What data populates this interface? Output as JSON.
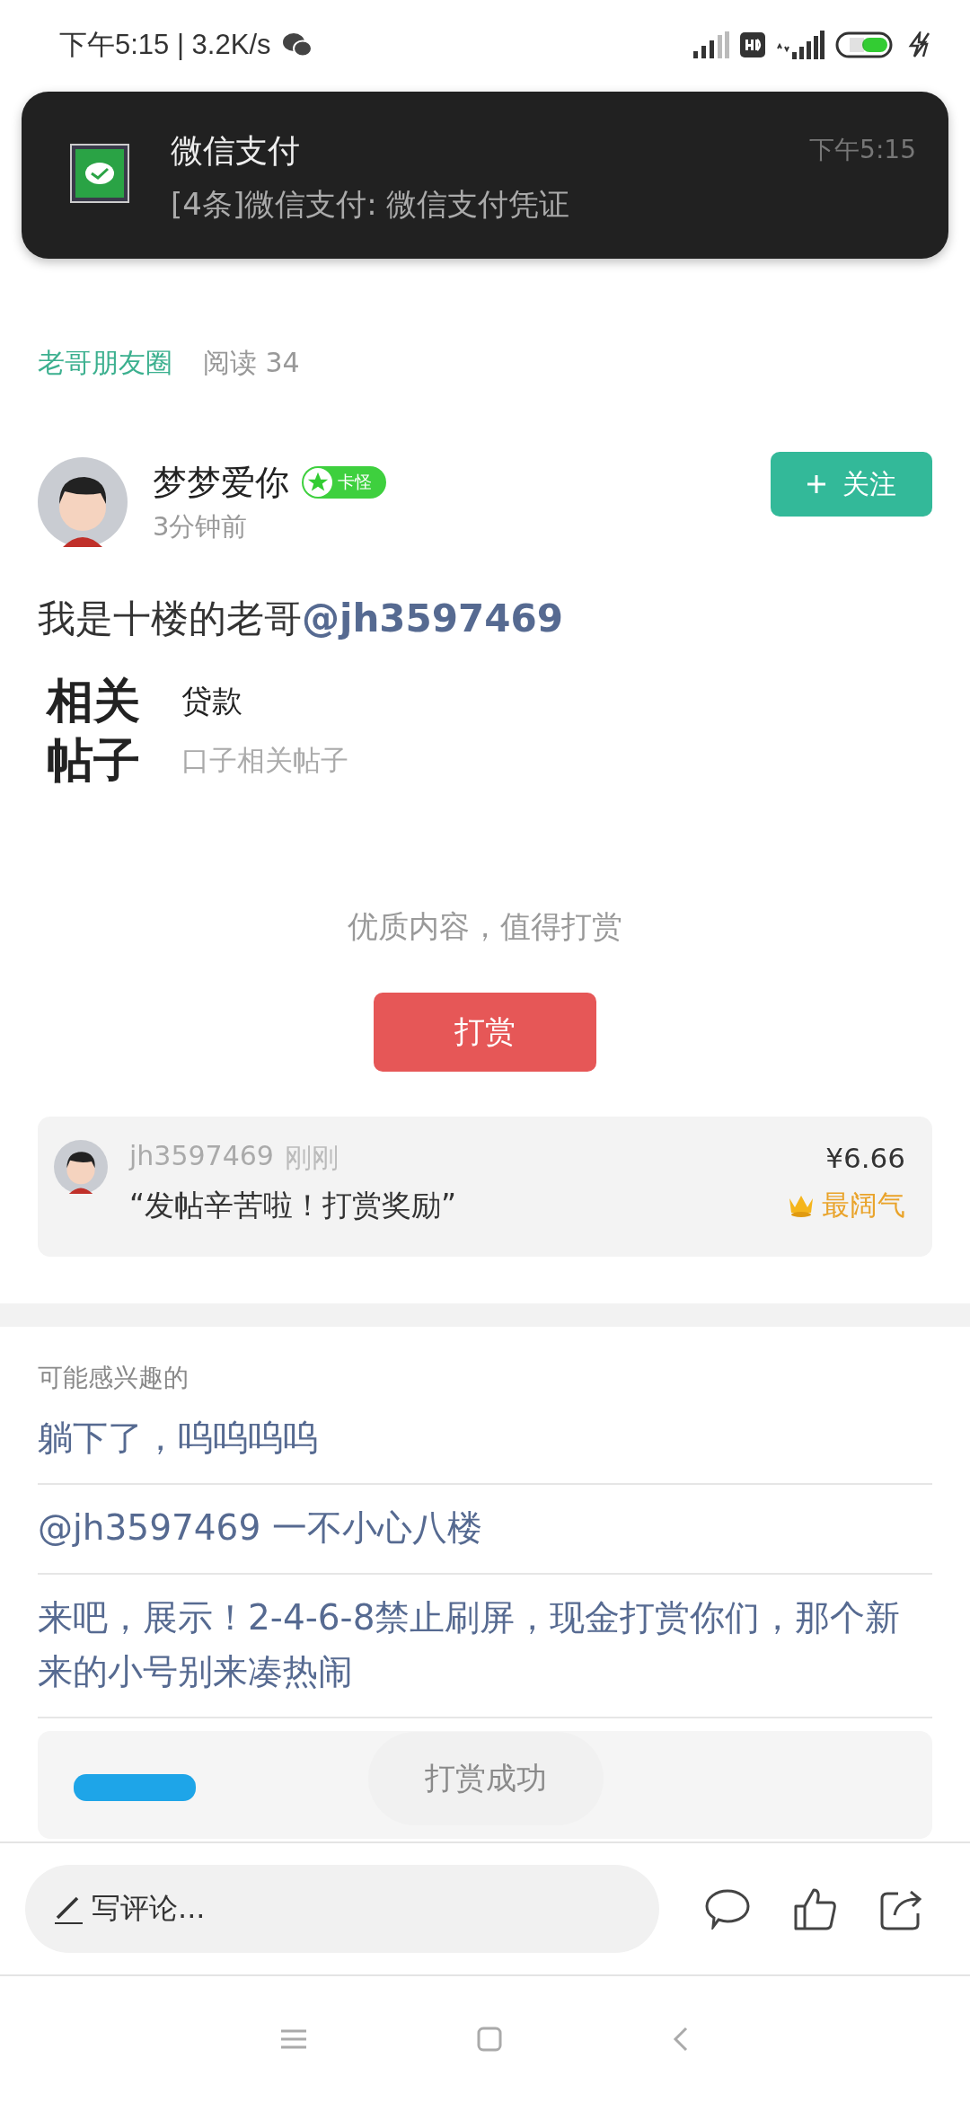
{
  "status_bar": {
    "left": "下午5:15 | 3.2K/s"
  },
  "notification": {
    "app": "微信支付",
    "message": "[4条]微信支付: 微信支付凭证",
    "time": "下午5:15"
  },
  "post": {
    "circle": "老哥朋友圈",
    "reads": "阅读 34",
    "author": {
      "name": "梦梦爱你",
      "badge": "卡怪",
      "time": "3分钟前"
    },
    "follow": "关注",
    "text": "我是十楼的老哥**@jh3597469**",
    "related": {
      "logo": "相关帖子",
      "items": [
        {
          "text": "贷款",
          "kind": "title"
        },
        {
          "text": "口子相关帖子",
          "kind": "sub"
        }
      ]
    }
  },
  "reward": {
    "prompt": "优质内容，值得打赏",
    "button": "打赏",
    "record": {
      "user": "jh3597469",
      "time": "刚刚",
      "message": "“发帖辛苦啦！打赏奖励”",
      "amount": "¥6.66",
      "tag": "最阔气"
    }
  },
  "interest": {
    "heading": "可能感兴趣的",
    "items": [
      "躺下了，呜呜呜呜",
      "@jh3597469 一不小心八楼",
      "来吧，展示！2-4-6-8禁止刷屏，现金打赏你们，那个新来的小号别来凑热闹"
    ]
  },
  "toast": "打赏成功",
  "comment_bar": {
    "placeholder": "写评论..."
  }
}
